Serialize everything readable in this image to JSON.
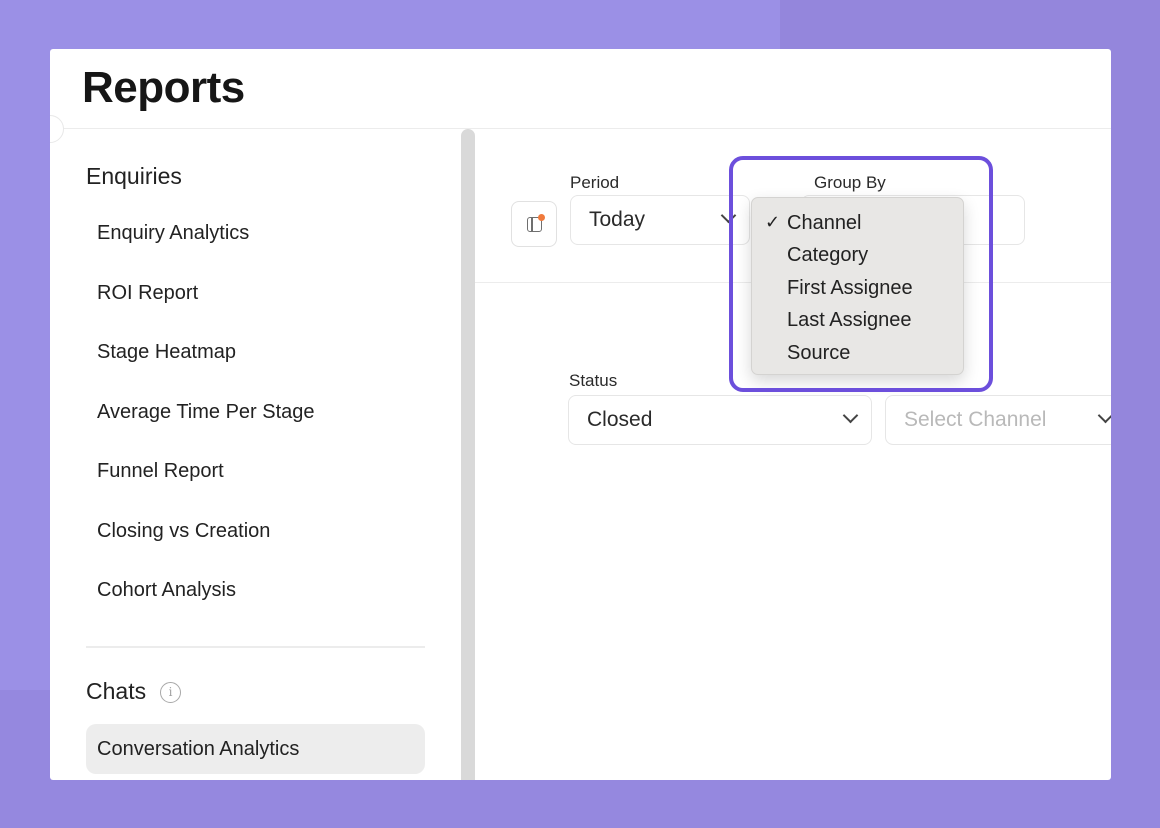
{
  "page": {
    "title": "Reports"
  },
  "sidebar": {
    "enquiries_heading": "Enquiries",
    "enquiries_items": [
      {
        "label": "Enquiry Analytics"
      },
      {
        "label": "ROI Report"
      },
      {
        "label": "Stage Heatmap"
      },
      {
        "label": "Average Time Per Stage"
      },
      {
        "label": "Funnel Report"
      },
      {
        "label": "Closing vs Creation"
      },
      {
        "label": "Cohort Analysis"
      }
    ],
    "chats_heading": "Chats",
    "chats_info_icon": "info-icon",
    "chats_items": [
      {
        "label": "Conversation Analytics",
        "active": true
      }
    ]
  },
  "filters": {
    "period": {
      "label": "Period",
      "value": "Today"
    },
    "group_by": {
      "label": "Group By"
    },
    "status": {
      "label": "Status",
      "value": "Closed"
    },
    "channel": {
      "placeholder": "Select Channel"
    }
  },
  "group_by_menu": {
    "selected": "Channel",
    "check_glyph": "✓",
    "options": [
      "Channel",
      "Category",
      "First Assignee",
      "Last Assignee",
      "Source"
    ]
  },
  "colors": {
    "background": "#9b90e6",
    "highlight_border": "#6c4fdc",
    "active_item": "#ededed",
    "notification_dot": "#f07a3c"
  }
}
